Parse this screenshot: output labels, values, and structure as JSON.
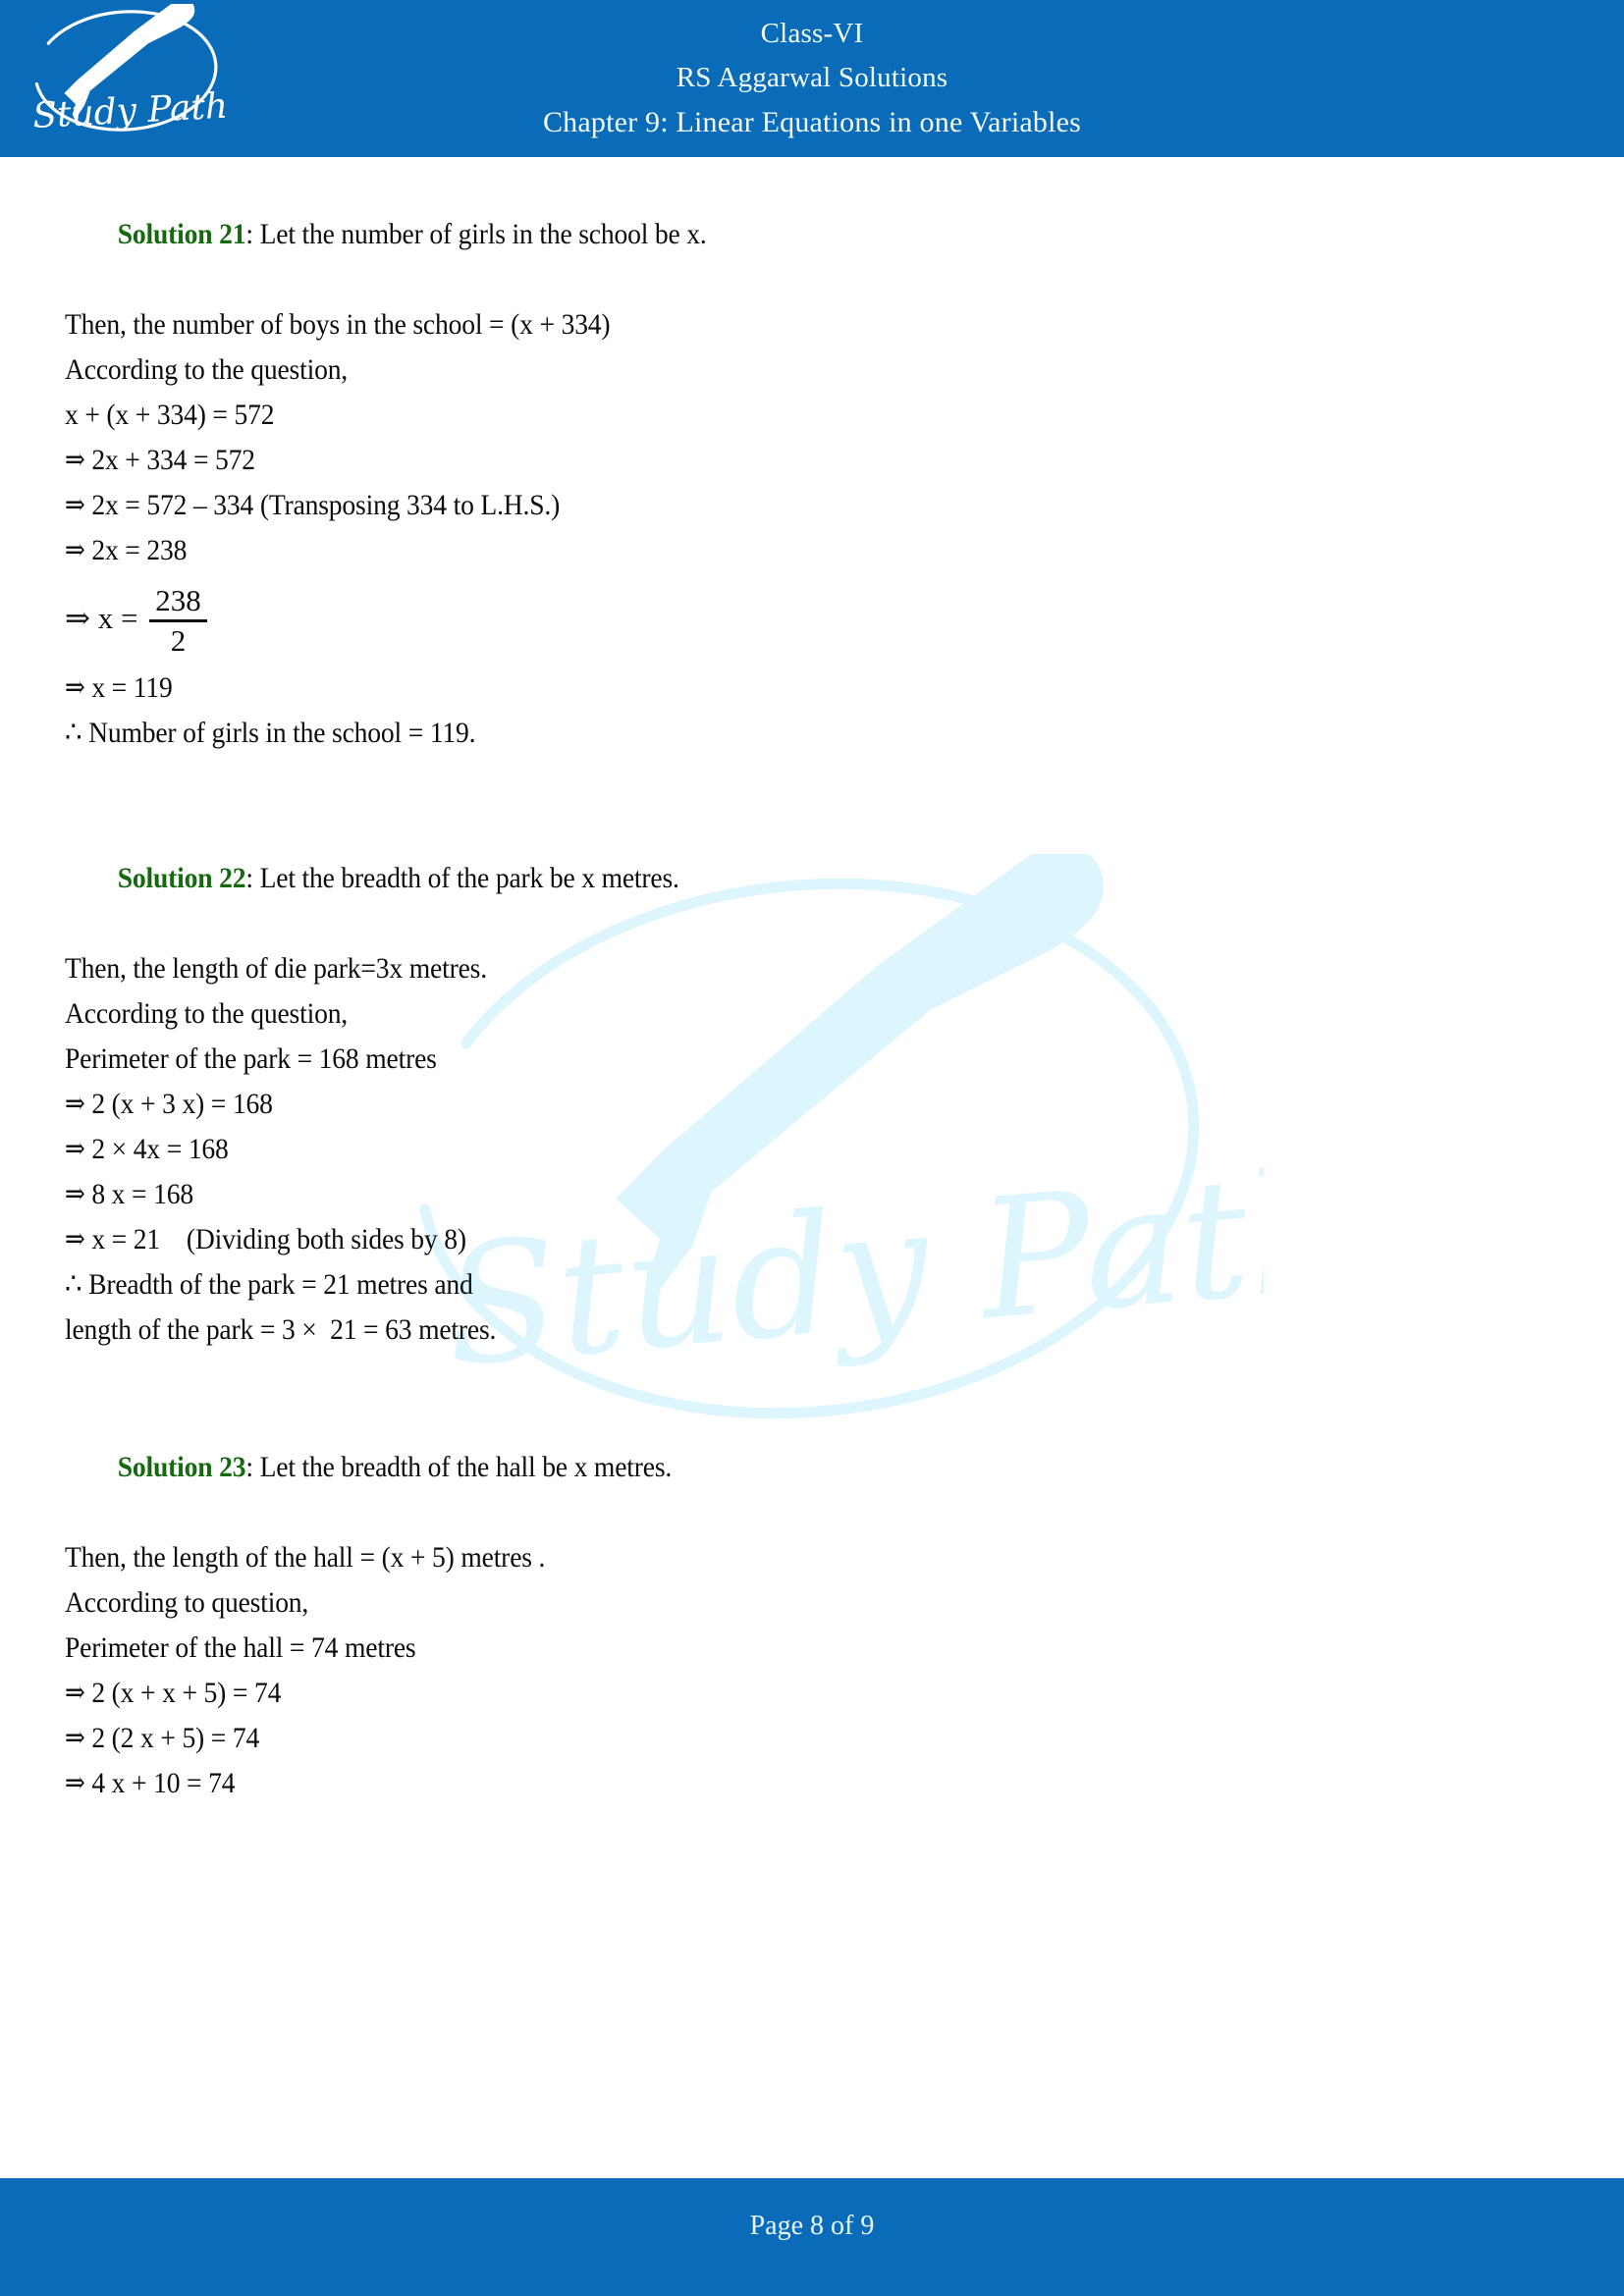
{
  "header": {
    "brand_name": "Study Path",
    "logo_icon": "fountain-pen-swoosh-logo",
    "line1": "Class-VI",
    "line2": "RS Aggarwal Solutions",
    "line3": "Chapter 9: Linear Equations in one Variables",
    "background_color": "#0a6cb8",
    "text_color": "#f4fbff"
  },
  "watermark": {
    "text": "Study Path",
    "icon": "fountain-pen-swoosh-logo",
    "color": "#ddf5fd"
  },
  "theme": {
    "solution_label_color": "#16690f",
    "body_text_color": "#0d0d0d",
    "page_background": "#ffffff"
  },
  "solutions": [
    {
      "label": "Solution 21",
      "label_suffix": ": ",
      "intro": "Let the number of girls in the school be x.",
      "lines": [
        "Then, the number of boys in the school = (x + 334)",
        "According to the question,",
        "x + (x + 334) = 572",
        "⇒ 2x + 334 = 572",
        "⇒ 2x = 572 – 334 (Transposing 334 to L.H.S.)",
        "⇒ 2x = 238"
      ],
      "fraction": {
        "lead": "⇒ x = ",
        "numerator": "238",
        "denominator": "2"
      },
      "lines_after": [
        "⇒ x = 119",
        "∴ Number of girls in the school = 119."
      ]
    },
    {
      "label": "Solution 22",
      "label_suffix": ": ",
      "intro": "Let the breadth of the park be x metres.",
      "lines": [
        "Then, the length of die park=3x metres.",
        "According to the question,",
        "Perimeter of the park = 168 metres",
        "⇒ 2 (x + 3 x) = 168",
        "⇒ 2 × 4x = 168",
        "⇒ 8 x = 168",
        "⇒ x = 21    (Dividing both sides by 8)",
        "∴ Breadth of the park = 21 metres and",
        "length of the park = 3 ×  21 = 63 metres."
      ]
    },
    {
      "label": "Solution 23",
      "label_suffix": ": ",
      "intro": "Let the breadth of the hall be x metres.",
      "lines": [
        "Then, the length of the hall = (x + 5) metres .",
        "According to question,",
        "Perimeter of the hall = 74 metres",
        "⇒ 2 (x + x + 5) = 74",
        "⇒ 2 (2 x + 5) = 74",
        "⇒ 4 x + 10 = 74"
      ]
    }
  ],
  "footer": {
    "page_text": "Page 8 of 9",
    "background_color": "#0a6cb8",
    "text_color": "#eaf6ff"
  }
}
